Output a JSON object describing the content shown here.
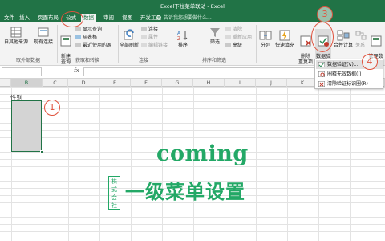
{
  "window": {
    "title": "Excel下拉菜单联动 - Excel"
  },
  "tabs": [
    {
      "label": "文件"
    },
    {
      "label": "插入"
    },
    {
      "label": "页面布局"
    },
    {
      "label": "公式"
    },
    {
      "label": "数据",
      "active": true
    },
    {
      "label": "审阅"
    },
    {
      "label": "视图"
    },
    {
      "label": "开发工具"
    }
  ],
  "tell_me": {
    "placeholder": "告诉我您想要做什么..."
  },
  "ribbon": {
    "get_external": {
      "button": "自其他来源",
      "group_label": "取外部数据"
    },
    "existing_conn": {
      "button": "现有连接"
    },
    "get_transform": {
      "new_query": "新建\n查询",
      "show_query": "显示查询",
      "from_table": "从表格",
      "recent_sources": "最近使用的源",
      "group_label": "获取和转换"
    },
    "connections": {
      "refresh_all": "全部刷新",
      "connections": "连接",
      "properties": "属性",
      "edit_links": "编辑链接",
      "group_label": "连接"
    },
    "sort_filter": {
      "sort": "排序",
      "filter": "筛选",
      "clear": "清除",
      "reapply": "重新应用",
      "advanced": "高级",
      "group_label": "排序和筛选"
    },
    "data_tools": {
      "text_to_columns": "分列",
      "flash_fill": "快速填充",
      "remove_duplicates": "删除\n重复项",
      "data_validation": "数据验\n证 -",
      "consolidate": "合并计算",
      "relationships": "关系",
      "manage_model": "管理数\n据模型"
    }
  },
  "validation_menu": {
    "items": [
      "数据验证(V)...",
      "圈释无效数据(I)",
      "清除验证标识圈(R)"
    ]
  },
  "formula_bar": {
    "fx": "fx",
    "value": ""
  },
  "columns": [
    "B",
    "C",
    "D",
    "E",
    "F",
    "G",
    "H",
    "I",
    "J",
    "K",
    "L",
    "M"
  ],
  "selected_column": "B",
  "sheet": {
    "header_cell": "性别"
  },
  "callouts": {
    "c1": "1",
    "c3": "3",
    "c4": "4"
  },
  "watermark": {
    "line1": "coming",
    "line2": "一级菜单设置",
    "seal": "株式会社"
  },
  "colors": {
    "excel_green": "#217346",
    "annotation_red": "#e0523d",
    "watermark_green": "#23a866"
  },
  "icons": [
    "search-icon",
    "sort-icon",
    "filter-icon",
    "data-validation-icon",
    "remove-duplicates-icon",
    "text-to-columns-icon"
  ]
}
